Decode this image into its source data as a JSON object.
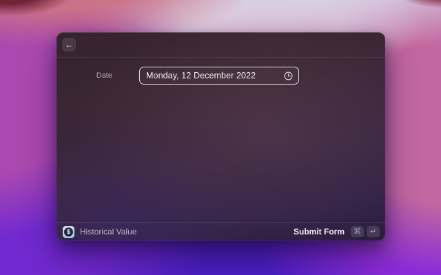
{
  "window": {
    "header": {
      "back_icon": "←"
    },
    "form": {
      "date_label": "Date",
      "date_value": "Monday, 12 December 2022"
    },
    "footer": {
      "extension_icon_glyph": "$",
      "command_title": "Historical Value",
      "primary_action_label": "Submit Form",
      "shortcut_keys": [
        "⌘",
        "↵"
      ]
    }
  },
  "colors": {
    "extension_icon_bg": "#a9c5de",
    "extension_icon_coin": "#1e2940",
    "field_border": "#ffffff",
    "wallpaper_magenta": "#ab49b0",
    "wallpaper_pink": "#c2679f",
    "wallpaper_indigo": "#4a1fc0"
  }
}
